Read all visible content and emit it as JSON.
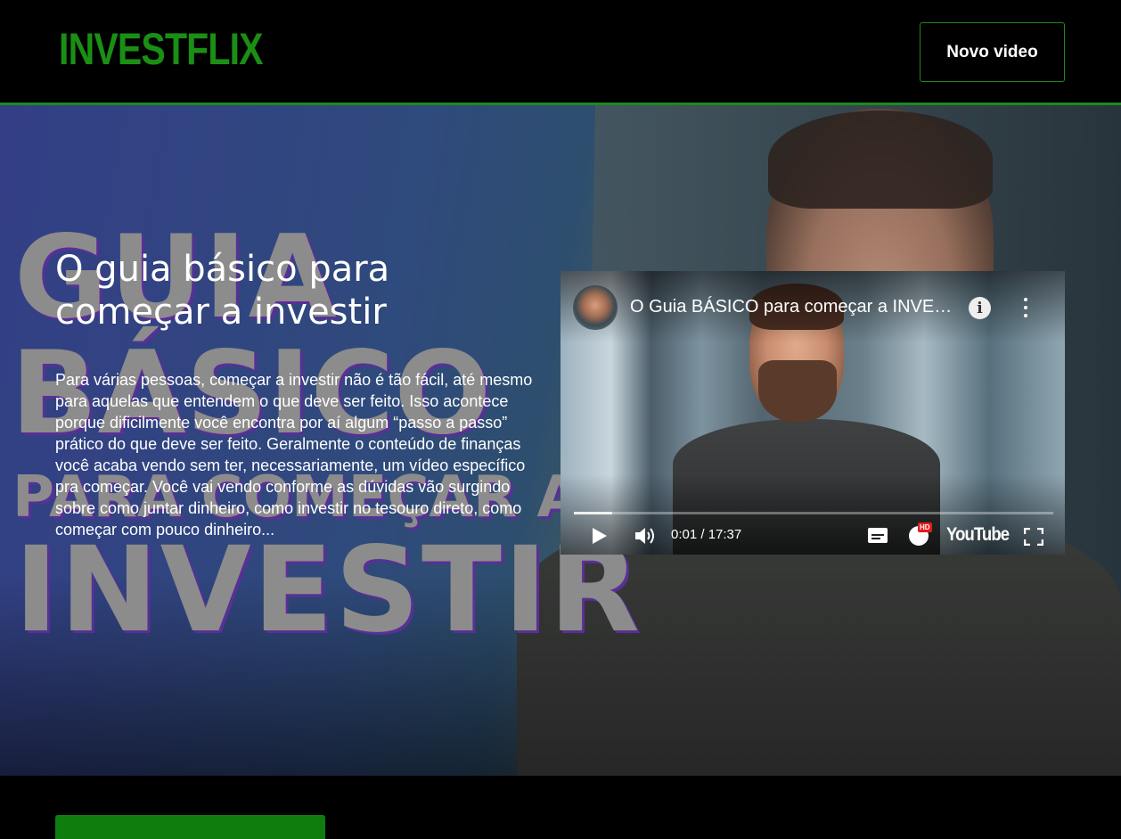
{
  "header": {
    "logo": "INVESTFLIX",
    "new_video_label": "Novo video"
  },
  "colors": {
    "brand_green": "#1a8f14",
    "header_border": "#1c8a1c",
    "background": "#000000"
  },
  "banner": {
    "background_words": [
      "GUIA",
      "BÁSICO",
      "PARA COMEÇAR A",
      "INVESTIR"
    ],
    "title": "O guia básico para começar a investir",
    "description": "Para várias pessoas, começar a investir não é tão fácil, até mesmo para aquelas que entendem o que deve ser feito. Isso acontece porque dificilmente você encontra por aí algum “passo a passo” prático do que deve ser feito. Geralmente o conteúdo de finanças você acaba vendo sem ter, necessariamente, um vídeo específico pra começar. Você vai vendo conforme as dúvidas vão surgindo sobre como juntar dinheiro, como investir no tesouro direto, como começar com pouco dinheiro..."
  },
  "video": {
    "title": "O Guia BÁSICO para começar a INVESTIR",
    "info_icon": "info-icon",
    "time": "0:01 / 17:37",
    "progress_fraction": 0.08,
    "hd_badge": "HD",
    "platform": "YouTube"
  }
}
